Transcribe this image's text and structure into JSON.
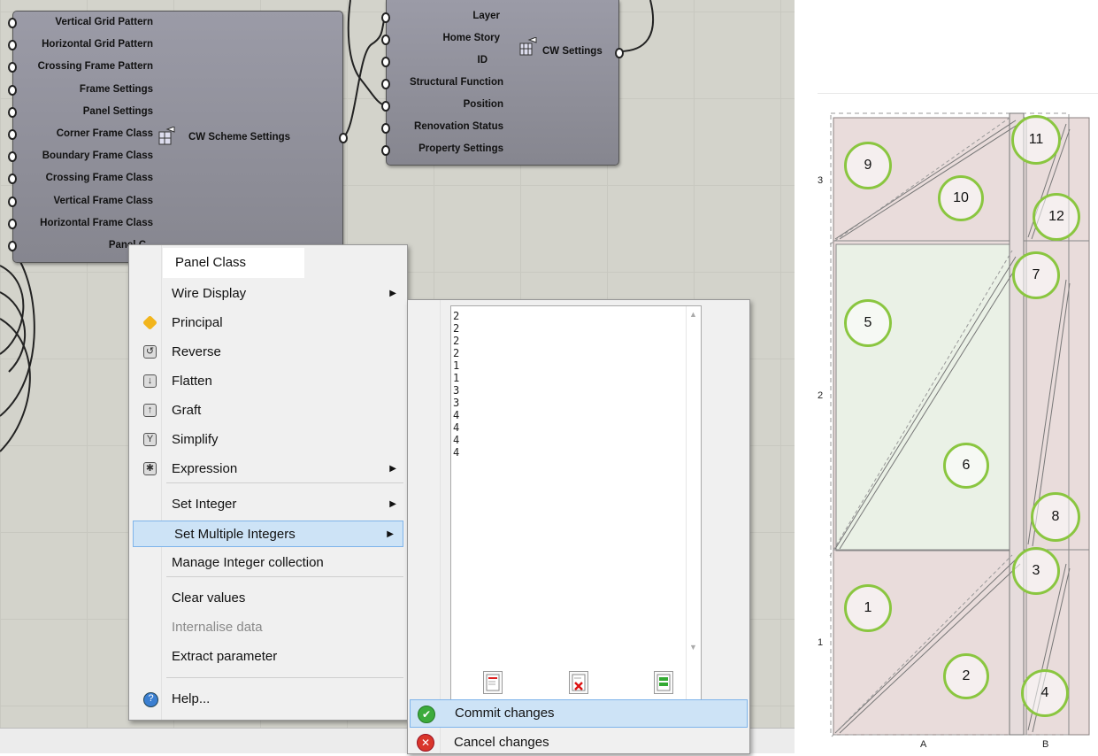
{
  "node_left": {
    "inputs": [
      "Vertical Grid Pattern",
      "Horizontal Grid Pattern",
      "Crossing Frame Pattern",
      "Frame Settings",
      "Panel Settings",
      "Corner Frame Class",
      "Boundary Frame Class",
      "Crossing Frame Class",
      "Vertical Frame Class",
      "Horizontal Frame Class",
      "Panel C"
    ],
    "output": "CW Scheme Settings"
  },
  "node_right": {
    "inputs": [
      "Layer",
      "Home Story",
      "ID",
      "Structural Function",
      "Position",
      "Renovation Status",
      "Property Settings"
    ],
    "output": "CW Settings"
  },
  "context_menu": {
    "header": "Panel Class",
    "items": [
      {
        "label": "Wire Display",
        "icon": "",
        "submenu": true
      },
      {
        "label": "Principal",
        "icon": "principal-icon"
      },
      {
        "label": "Reverse",
        "icon": "reverse-icon"
      },
      {
        "label": "Flatten",
        "icon": "flatten-icon"
      },
      {
        "label": "Graft",
        "icon": "graft-icon"
      },
      {
        "label": "Simplify",
        "icon": "simplify-icon"
      },
      {
        "label": "Expression",
        "icon": "expression-icon",
        "submenu": true
      },
      {
        "label": "Set Integer",
        "submenu": true
      },
      {
        "label": "Set Multiple Integers",
        "submenu": true,
        "highlighted": true
      },
      {
        "label": "Manage Integer collection"
      },
      {
        "label": "Clear values"
      },
      {
        "label": "Internalise data",
        "disabled": true
      },
      {
        "label": "Extract parameter"
      },
      {
        "label": "Help...",
        "icon": "help-icon"
      }
    ]
  },
  "submenu": {
    "values": [
      "2",
      "2",
      "2",
      "2",
      "1",
      "1",
      "3",
      "3",
      "4",
      "4",
      "4",
      "4"
    ],
    "commit_label": "Commit changes",
    "cancel_label": "Cancel changes"
  },
  "diagram": {
    "row_labels": [
      "3",
      "2",
      "1"
    ],
    "col_labels": [
      "A",
      "B"
    ],
    "panel_numbers": [
      "9",
      "10",
      "11",
      "12",
      "5",
      "7",
      "6",
      "8",
      "1",
      "3",
      "2",
      "4"
    ],
    "colors": {
      "circle": "#8ac640",
      "panel_pink": "#e9dcdb",
      "panel_green": "#eaf1e6"
    }
  }
}
